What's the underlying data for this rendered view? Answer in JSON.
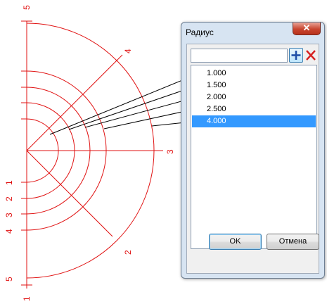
{
  "drawing": {
    "line_color": "#e01010",
    "ring_radius_labels": [
      "1",
      "2",
      "3",
      "4",
      "5"
    ],
    "axis_labels": {
      "vertical_top": "5",
      "vertical_bottom": "1",
      "horizontal_right": "3",
      "diagonal_up": "4",
      "diagonal_down": "2",
      "bottom_left": "5"
    }
  },
  "dialog": {
    "title": "Радиус",
    "close_label": "✕",
    "radius_input": {
      "value": "",
      "placeholder": ""
    },
    "add_icon": "plus-icon",
    "delete_icon": "delete-icon",
    "radius_list": [
      {
        "label": "1.000",
        "selected": false
      },
      {
        "label": "1.500",
        "selected": false
      },
      {
        "label": "2.000",
        "selected": false
      },
      {
        "label": "2.500",
        "selected": false
      },
      {
        "label": "4.000",
        "selected": true
      }
    ],
    "ok_label": "OK",
    "cancel_label": "Отмена",
    "selection_color": "#3399ff"
  }
}
